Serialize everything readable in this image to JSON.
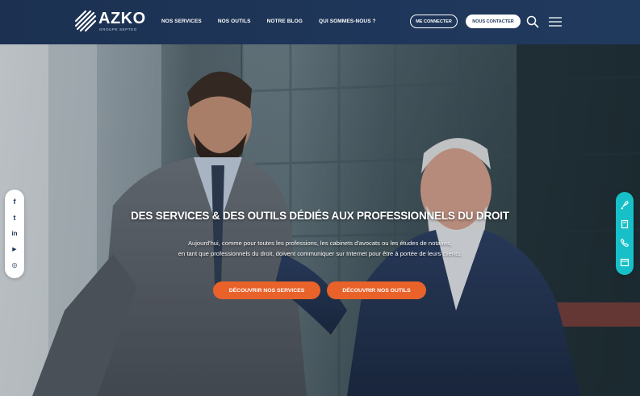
{
  "brand": {
    "name": "AZKO",
    "tagline": "GROUPE SEPTEO"
  },
  "nav": {
    "items": [
      "NOS SERVICES",
      "NOS OUTILS",
      "NOTRE BLOG",
      "QUI SOMMES-NOUS ?"
    ]
  },
  "header": {
    "login_label": "ME CONNECTER",
    "contact_label": "NOUS CONTACTER"
  },
  "hero": {
    "title": "DES SERVICES & DES OUTILS DÉDIÉS AUX PROFESSIONNELS DU DROIT",
    "text_line1": "Aujourd'hui, comme pour toutes les professions, les cabinets d'avocats ou les études de notaires,",
    "text_line2": "en tant que professionnels du droit, doivent communiquer sur Internet pour être à portée de leurs clients.",
    "cta_services": "DÉCOUVRIR NOS SERVICES",
    "cta_tools": "DÉCOUVRIR NOS OUTILS"
  },
  "social": {
    "icons": [
      "facebook-icon",
      "twitter-icon",
      "linkedin-icon",
      "youtube-icon",
      "instagram-icon"
    ],
    "glyphs": [
      "f",
      "t",
      "in",
      "▶",
      "◎"
    ]
  },
  "quick_actions": {
    "icons": [
      "rocket-icon",
      "book-icon",
      "phone-icon",
      "calendar-icon"
    ]
  },
  "colors": {
    "header_bg": "#1d3557",
    "accent_orange": "#e9622a",
    "accent_teal": "#17c0c9"
  }
}
